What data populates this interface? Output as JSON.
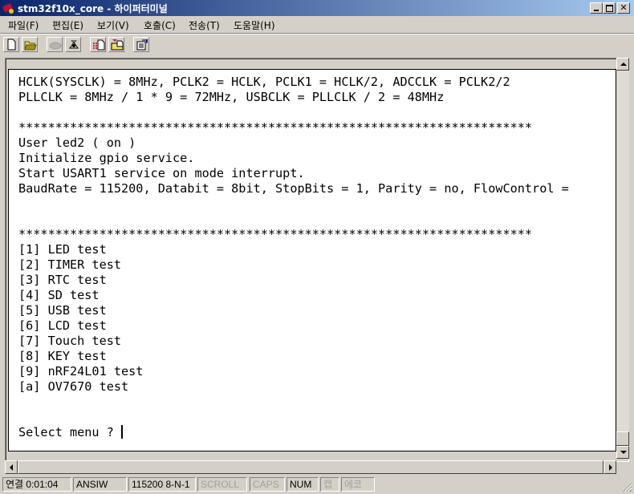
{
  "window": {
    "title": "stm32f10x_core - 하이퍼터미널",
    "controls": {
      "minimize": "_",
      "maximize": "□",
      "close": "✕"
    }
  },
  "menu": {
    "items": [
      {
        "label": "파일(F)"
      },
      {
        "label": "편집(E)"
      },
      {
        "label": "보기(V)"
      },
      {
        "label": "호출(C)"
      },
      {
        "label": "전송(T)"
      },
      {
        "label": "도움말(H)"
      }
    ]
  },
  "toolbar": {
    "buttons": [
      {
        "icon": "new-document-icon"
      },
      {
        "icon": "open-folder-icon"
      },
      {
        "icon": "connect-phone-icon",
        "disabled": true
      },
      {
        "icon": "disconnect-phone-icon"
      },
      {
        "icon": "send-file-icon"
      },
      {
        "icon": "receive-file-icon"
      },
      {
        "icon": "properties-icon"
      }
    ]
  },
  "terminal": {
    "lines": [
      "HCLK(SYSCLK) = 8MHz, PCLK2 = HCLK, PCLK1 = HCLK/2, ADCCLK = PCLK2/2",
      "PLLCLK = 8MHz / 1 * 9 = 72MHz, USBCLK = PLLCLK / 2 = 48MHz",
      "",
      "**********************************************************************",
      "User led2 ( on )",
      "Initialize gpio service.",
      "Start USART1 service on mode interrupt.",
      "BaudRate = 115200, Databit = 8bit, StopBits = 1, Parity = no, FlowControl =",
      "",
      "",
      "**********************************************************************",
      "[1] LED test",
      "[2] TIMER test",
      "[3] RTC test",
      "[4] SD test",
      "[5] USB test",
      "[6] LCD test",
      "[7] Touch test",
      "[8] KEY test",
      "[9] nRF24L01 test",
      "[a] OV7670 test",
      "",
      ""
    ],
    "prompt": "Select menu ? "
  },
  "status": {
    "connection": "연결 0:01:04",
    "emulation": "ANSIW",
    "port_settings": "115200 8-N-1",
    "scroll": "SCROLL",
    "caps": "CAPS",
    "num": "NUM",
    "capture": "캡",
    "echo": "에코"
  }
}
